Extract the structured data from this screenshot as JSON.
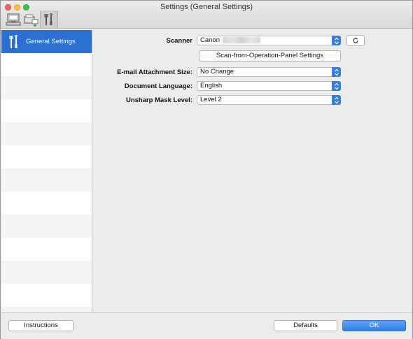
{
  "window": {
    "title": "Settings (General Settings)"
  },
  "toolbar": {
    "tabs": [
      {
        "icon": "scan-from-computer-icon",
        "selected": false
      },
      {
        "icon": "scan-from-panel-icon",
        "selected": false
      },
      {
        "icon": "general-settings-tools-icon",
        "selected": true
      }
    ]
  },
  "sidebar": {
    "items": [
      {
        "label": "General Settings",
        "icon": "general-settings-tools-icon",
        "selected": true
      }
    ]
  },
  "form": {
    "scanner_label": "Scanner",
    "scanner_value": "Canon",
    "panel_settings_button": "Scan-from-Operation-Panel Settings",
    "email_label": "E-mail Attachment Size:",
    "email_value": "No Change",
    "language_label": "Document Language:",
    "language_value": "English",
    "unsharp_label": "Unsharp Mask Level:",
    "unsharp_value": "Level 2"
  },
  "footer": {
    "instructions_button": "Instructions",
    "defaults_button": "Defaults",
    "ok_button": "OK"
  },
  "colors": {
    "accent": "#2a6fd1",
    "popup_arrow": "#3b7ddd"
  }
}
